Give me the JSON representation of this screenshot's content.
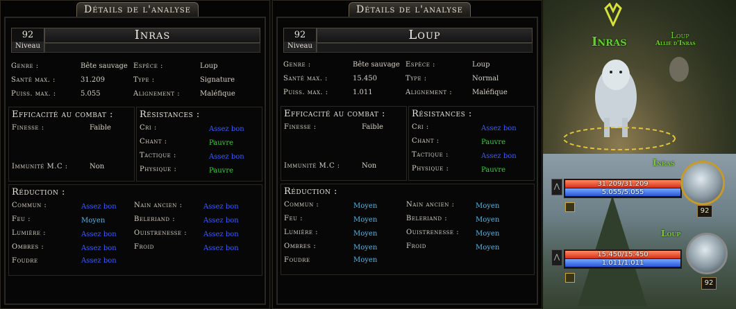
{
  "panels": [
    {
      "title": "Détails de l'analyse",
      "level": "92",
      "level_label": "Niveau",
      "name": "Inras",
      "stats": [
        {
          "label": "Genre :",
          "value": "Bête sauvage"
        },
        {
          "label": "Santé max. :",
          "value": "31.209"
        },
        {
          "label": "Puiss. max. :",
          "value": "5.055"
        }
      ],
      "stats_right": [
        {
          "label": "Espèce :",
          "value": "Loup"
        },
        {
          "label": "Type :",
          "value": "Signature"
        },
        {
          "label": "Alignement :",
          "value": "Maléfique"
        }
      ],
      "combat": {
        "header": "Efficacité au combat :",
        "rows": [
          {
            "label": "Finesse :",
            "value": "Faible"
          },
          {
            "label": "Immunité M.C :",
            "value": "Non"
          }
        ]
      },
      "resist": {
        "header": "Résistances :",
        "rows": [
          {
            "label": "Cri :",
            "value": "Assez bon",
            "cls": "good"
          },
          {
            "label": "Chant :",
            "value": "Pauvre",
            "cls": "poor"
          },
          {
            "label": "Tactique :",
            "value": "Assez bon",
            "cls": "good"
          },
          {
            "label": "Physique :",
            "value": "Pauvre",
            "cls": "poor"
          }
        ]
      },
      "reduction": {
        "header": "Réduction :",
        "left": [
          {
            "label": "Commun :",
            "value": "Assez bon",
            "cls": "good"
          },
          {
            "label": "Feu :",
            "value": "Moyen",
            "cls": "avg"
          },
          {
            "label": "Lumière :",
            "value": "Assez bon",
            "cls": "good"
          },
          {
            "label": "Ombres :",
            "value": "Assez bon",
            "cls": "good"
          },
          {
            "label": "Foudre",
            "value": "Assez bon",
            "cls": "good"
          }
        ],
        "right": [
          {
            "label": "Nain ancien :",
            "value": "Assez bon",
            "cls": "good"
          },
          {
            "label": "Beleriand :",
            "value": "Assez bon",
            "cls": "good"
          },
          {
            "label": "Ouistrenesse :",
            "value": "Assez bon",
            "cls": "good"
          },
          {
            "label": "Froid",
            "value": "Assez bon",
            "cls": "good"
          }
        ]
      }
    },
    {
      "title": "Détails de l'analyse",
      "level": "92",
      "level_label": "Niveau",
      "name": "Loup",
      "stats": [
        {
          "label": "Genre :",
          "value": "Bête sauvage"
        },
        {
          "label": "Santé max. :",
          "value": "15.450"
        },
        {
          "label": "Puiss. max. :",
          "value": "1.011"
        }
      ],
      "stats_right": [
        {
          "label": "Espèce :",
          "value": "Loup"
        },
        {
          "label": "Type :",
          "value": "Normal"
        },
        {
          "label": "Alignement :",
          "value": "Maléfique"
        }
      ],
      "combat": {
        "header": "Efficacité au combat :",
        "rows": [
          {
            "label": "Finesse :",
            "value": "Faible"
          },
          {
            "label": "Immunité M.C :",
            "value": "Non"
          }
        ]
      },
      "resist": {
        "header": "Résistances :",
        "rows": [
          {
            "label": "Cri :",
            "value": "Assez bon",
            "cls": "good"
          },
          {
            "label": "Chant :",
            "value": "Pauvre",
            "cls": "poor"
          },
          {
            "label": "Tactique :",
            "value": "Assez bon",
            "cls": "good"
          },
          {
            "label": "Physique :",
            "value": "Pauvre",
            "cls": "poor"
          }
        ]
      },
      "reduction": {
        "header": "Réduction :",
        "left": [
          {
            "label": "Commun :",
            "value": "Moyen",
            "cls": "avg"
          },
          {
            "label": "Feu :",
            "value": "Moyen",
            "cls": "avg"
          },
          {
            "label": "Lumière :",
            "value": "Moyen",
            "cls": "avg"
          },
          {
            "label": "Ombres :",
            "value": "Moyen",
            "cls": "avg"
          },
          {
            "label": "Foudre",
            "value": "Moyen",
            "cls": "avg"
          }
        ],
        "right": [
          {
            "label": "Nain ancien :",
            "value": "Moyen",
            "cls": "avg"
          },
          {
            "label": "Beleriand :",
            "value": "Moyen",
            "cls": "avg"
          },
          {
            "label": "Ouistrenesse :",
            "value": "Moyen",
            "cls": "avg"
          },
          {
            "label": "Froid",
            "value": "Moyen",
            "cls": "avg"
          }
        ]
      }
    }
  ],
  "scene": {
    "target_name": "Inras",
    "pet_name": "Loup",
    "pet_subtitle": "Allié d'Inras"
  },
  "unit_frames": [
    {
      "name": "Inras",
      "health": "31.209/31.209",
      "power": "5.055/5.055",
      "level": "92",
      "health_fill": 1.0,
      "power_fill": 1.0
    },
    {
      "name": "Loup",
      "health": "15.450/15.450",
      "power": "1.011/1.011",
      "level": "92",
      "health_fill": 1.0,
      "power_fill": 1.0
    }
  ],
  "colors": {
    "good": "#3d5cff",
    "poor": "#36d236",
    "average": "#4fb8e8",
    "name_green": "#7ecb3a"
  }
}
